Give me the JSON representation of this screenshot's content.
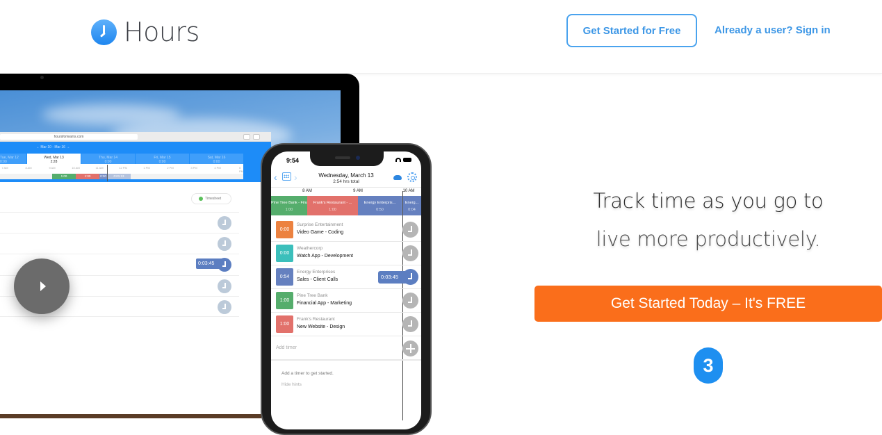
{
  "header": {
    "logo_text": "Hours",
    "get_started_label": "Get Started for Free",
    "signin_label": "Already a user? Sign in"
  },
  "laptop": {
    "url": "hoursforteams.com",
    "week_range": "← Mar 10 - Mar 16 →",
    "day_tabs": [
      {
        "day": "Tue, Mar 12",
        "total": "0:00"
      },
      {
        "day": "Wed, Mar 13",
        "total": "2:28",
        "active": true
      },
      {
        "day": "Thu, Mar 14",
        "total": "0:00"
      },
      {
        "day": "Fri, Mar 15",
        "total": "0:00"
      },
      {
        "day": "Sat, Mar 16",
        "total": "0:00"
      }
    ],
    "time_ticks": [
      "7 AM",
      "8 AM",
      "9 AM",
      "10 AM",
      "11 AM",
      "12 PM",
      "1 PM",
      "2 PM",
      "3 PM",
      "4 PM",
      "5 PM"
    ],
    "timeline_segments": [
      {
        "label": "1:00",
        "color": "#55ad6c"
      },
      {
        "label": "1:00",
        "color": "#e2716b"
      },
      {
        "label": "0:30",
        "color": "#7a8fc4"
      },
      {
        "label": "0:01:13",
        "color": "#b5c3dd"
      }
    ],
    "timesheet_label": "Timesheet",
    "running_timer": "0:03:45"
  },
  "phone": {
    "time": "9:54",
    "date": "Wednesday, March 13",
    "total": "2:54 hrs total",
    "scale": [
      "8 AM",
      "9 AM",
      "10 AM"
    ],
    "timeline": [
      {
        "name": "Pine Tree Bank - Fina...",
        "dur": "1:00",
        "color": "#55ad6c"
      },
      {
        "name": "Frank's Restaurant - ...",
        "dur": "1:00",
        "color": "#e2716b"
      },
      {
        "name": "Energy Enterpris...",
        "dur": "0:50",
        "color": "#6580bf"
      },
      {
        "name": "Energ...",
        "dur": "0:04",
        "color": "#6580bf"
      }
    ],
    "timers": [
      {
        "badge": "0:00",
        "color": "#ec8240",
        "client": "Surprise Entertainment",
        "project": "Video Game - Coding"
      },
      {
        "badge": "0:00",
        "color": "#3bbfbb",
        "client": "Weathercorp",
        "project": "Watch App - Development"
      },
      {
        "badge": "0:54",
        "color": "#6580bf",
        "client": "Energy Enterprises",
        "project": "Sales - Client Calls",
        "running": "0:03:45"
      },
      {
        "badge": "1:00",
        "color": "#55ad6c",
        "client": "Pine Tree Bank",
        "project": "Financial App - Marketing"
      },
      {
        "badge": "1:00",
        "color": "#e2716b",
        "client": "Frank's Restaurant",
        "project": "New Website - Design"
      }
    ],
    "add_timer_placeholder": "Add timer",
    "hint": "Add a timer to get started.",
    "hide_hints": "Hide hints"
  },
  "hero": {
    "headline_line1": "Track time as you go to",
    "headline_line2": "live more productively.",
    "cta_label": "Get Started Today – It's FREE",
    "step_number": "3"
  },
  "colors": {
    "brand_blue": "#3d97e6",
    "cta_orange": "#fa6e1b",
    "badge_blue": "#1e8ff0"
  }
}
